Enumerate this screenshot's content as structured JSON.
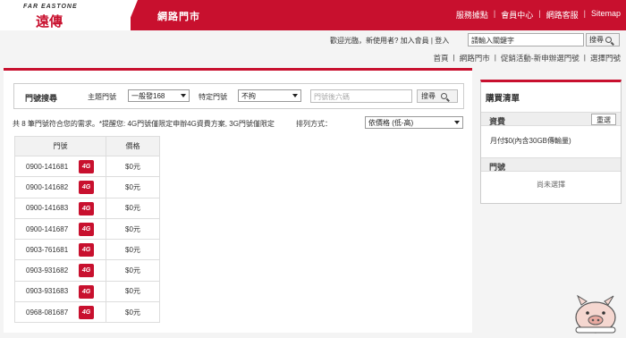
{
  "brand": {
    "logo_en": "FAR EASTONE",
    "logo_zh": "遠傳",
    "site_title": "網路門市"
  },
  "topnav": [
    "服務據點",
    "會員中心",
    "網路客服",
    "Sitemap"
  ],
  "welcome": {
    "prefix": "歡迎光臨，新使用者?",
    "join": "加入會員",
    "sep": "|",
    "login": "登入"
  },
  "site_search": {
    "placeholder": "請輸入關鍵字",
    "button": "搜尋"
  },
  "breadcrumb": [
    "首頁",
    "網路門市",
    "促銷活動-新申辦選門號",
    "選擇門號"
  ],
  "filter": {
    "title": "門號搜尋",
    "theme_label": "主題門號",
    "theme_value": "一般發168",
    "special_label": "特定門號",
    "special_value": "不拘",
    "number_placeholder": "門號後六碼",
    "search_button": "搜尋"
  },
  "info_text": "共 8 筆門號符合您的需求。*提醒您: 4G門號僅限定申辦4G資費方案, 3G門號僅限定",
  "sort": {
    "label": "排列方式：",
    "value": "依價格 (低-高)"
  },
  "table": {
    "headers": [
      "門號",
      "價格"
    ],
    "badge": "4G",
    "rows": [
      {
        "number": "0900-141681",
        "price": "$0元"
      },
      {
        "number": "0900-141682",
        "price": "$0元"
      },
      {
        "number": "0900-141683",
        "price": "$0元"
      },
      {
        "number": "0900-141687",
        "price": "$0元"
      },
      {
        "number": "0903-761681",
        "price": "$0元"
      },
      {
        "number": "0903-931682",
        "price": "$0元"
      },
      {
        "number": "0903-931683",
        "price": "$0元"
      },
      {
        "number": "0968-081687",
        "price": "$0元"
      }
    ]
  },
  "cart": {
    "title": "購買清單",
    "plan_header": "資費",
    "reset_button": "重選",
    "plan_value": "月付$0(內含30GB傳輸量)",
    "number_header": "門號",
    "number_value": "尚未選擇"
  },
  "colors": {
    "brand_red": "#c8102e"
  }
}
